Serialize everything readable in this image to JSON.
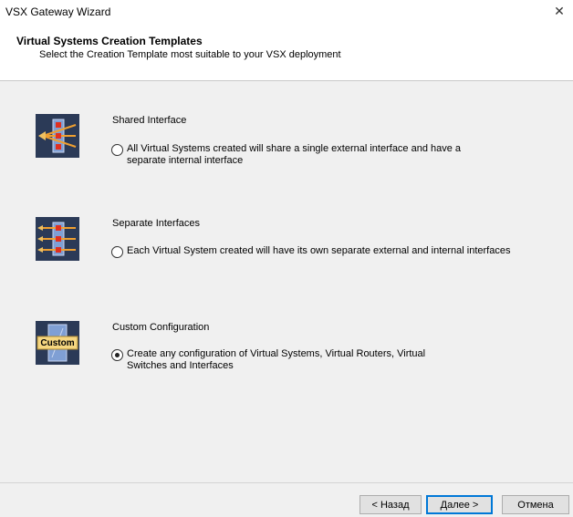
{
  "window": {
    "title": "VSX Gateway Wizard"
  },
  "header": {
    "title": "Virtual Systems Creation Templates",
    "subtitle": "Select the Creation Template most suitable to your VSX deployment"
  },
  "options": [
    {
      "title": "Shared Interface",
      "label": "All Virtual Systems created will share a single external interface and have a separate internal interface",
      "checked": false,
      "icon": "shared-interface-icon"
    },
    {
      "title": "Separate Interfaces",
      "label": "Each Virtual System created will have its own separate external and internal interfaces",
      "checked": false,
      "icon": "separate-interfaces-icon"
    },
    {
      "title": "Custom Configuration",
      "label": "Create any configuration of Virtual Systems, Virtual Routers, Virtual Switches and Interfaces",
      "checked": true,
      "icon": "custom-configuration-icon",
      "icon_text": "Custom"
    }
  ],
  "buttons": {
    "back": "< Назад",
    "next_prefix": "",
    "next_underlined": "Д",
    "next_rest": "алее >",
    "cancel": "Отмена"
  },
  "colors": {
    "accent": "#0078d7",
    "icon_bg": "#2b3a57",
    "icon_orange": "#f0a030",
    "icon_red": "#e03020"
  }
}
